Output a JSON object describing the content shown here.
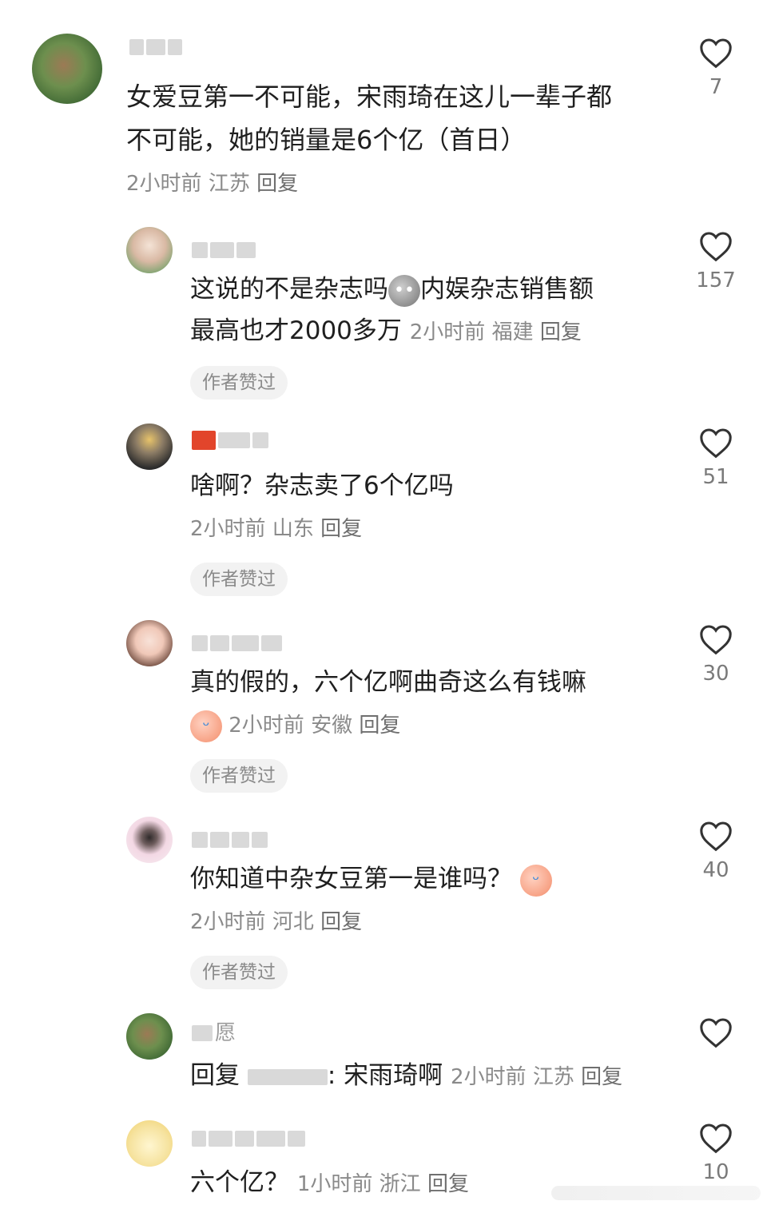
{
  "comments": [
    {
      "text_lines": [
        "女爱豆第一不可能，宋雨琦在这儿一辈子都",
        "不可能，她的销量是6个亿（首日）"
      ],
      "time": "2小时前",
      "location": "江苏",
      "reply": "回复",
      "likes": "7"
    },
    {
      "text_lines": [
        "这说的不是杂志吗",
        "内娱杂志销售额",
        "最高也才2000多万"
      ],
      "time": "2小时前",
      "location": "福建",
      "reply": "回复",
      "badge": "作者赞过",
      "likes": "157"
    },
    {
      "text": "啥啊？杂志卖了6个亿吗",
      "time": "2小时前",
      "location": "山东",
      "reply": "回复",
      "badge": "作者赞过",
      "likes": "51"
    },
    {
      "text": "真的假的，六个亿啊曲奇这么有钱嘛",
      "time": "2小时前",
      "location": "安徽",
      "reply": "回复",
      "badge": "作者赞过",
      "likes": "30"
    },
    {
      "text": "你知道中杂女豆第一是谁吗？",
      "time": "2小时前",
      "location": "河北",
      "reply": "回复",
      "badge": "作者赞过",
      "likes": "40"
    },
    {
      "reply_prefix": "回复",
      "reply_text": ": 宋雨琦啊",
      "username_partial": "愿",
      "time": "2小时前",
      "location": "江苏",
      "reply": "回复",
      "likes": ""
    },
    {
      "text": "六个亿？",
      "time": "1小时前",
      "location": "浙江",
      "reply": "回复",
      "likes": "10"
    }
  ],
  "icons": {
    "heart": "heart-outline-icon",
    "emoji_crying": "crying-laugh-emoji",
    "emoji_gray": "gray-face-emoji"
  },
  "colors": {
    "text": "#1f1f1f",
    "meta": "#8a8a8a",
    "badge_bg": "#f2f2f2"
  }
}
